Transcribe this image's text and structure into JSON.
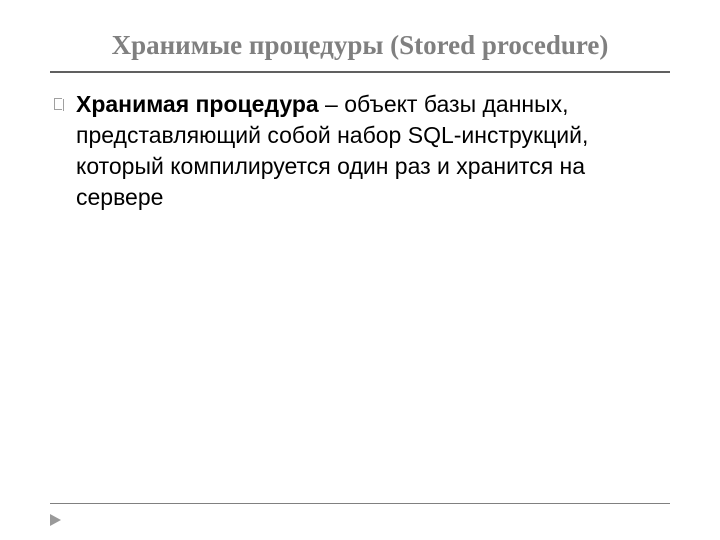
{
  "slide": {
    "title": "Хранимые процедуры (Stored procedure)",
    "bullet": {
      "bold": "Хранимая процедура",
      "rest": " – объект базы данных, представляющий собой набор SQL-инструкций, который компилируется один раз и хранится на сервере"
    }
  }
}
